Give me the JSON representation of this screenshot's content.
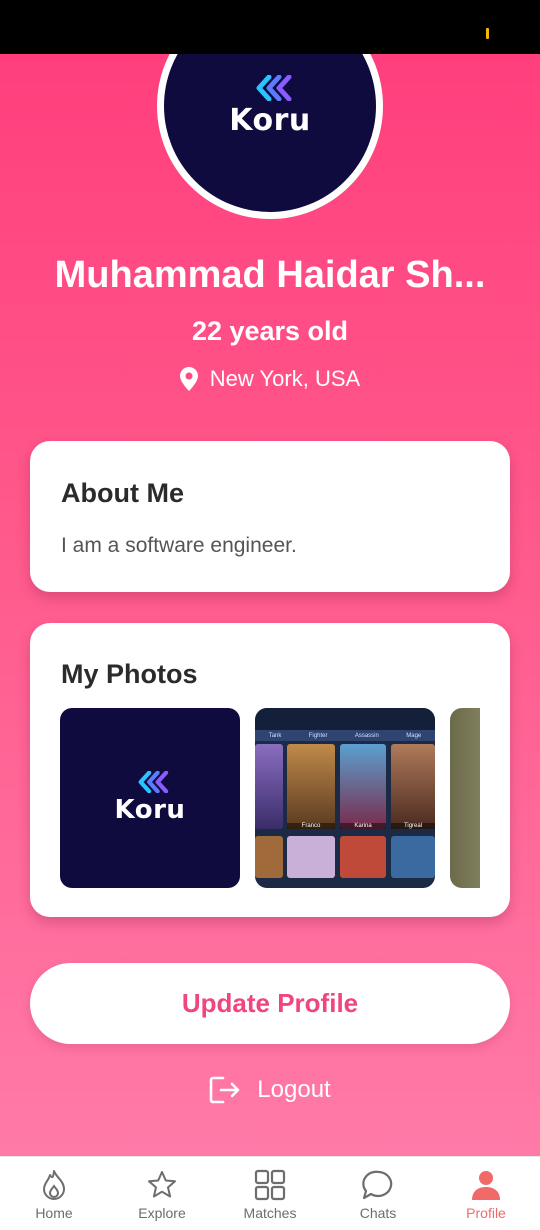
{
  "profile": {
    "name": "Muhammad Haidar Sh...",
    "age": "22 years old",
    "location": "New York, USA",
    "avatar_logo": "Koru"
  },
  "about": {
    "title": "About Me",
    "text": "I am a software engineer."
  },
  "photos": {
    "title": "My Photos",
    "items": [
      {
        "logo": "Koru"
      },
      {
        "tabs": [
          "Tank",
          "Fighter",
          "Assassin",
          "Mage"
        ],
        "heroes": [
          "Franco",
          "Karina",
          "Tigreal"
        ]
      },
      {}
    ]
  },
  "actions": {
    "update_label": "Update Profile",
    "logout_label": "Logout"
  },
  "nav": {
    "items": [
      {
        "label": "Home",
        "icon": "flame-icon"
      },
      {
        "label": "Explore",
        "icon": "star-icon"
      },
      {
        "label": "Matches",
        "icon": "grid-icon"
      },
      {
        "label": "Chats",
        "icon": "chat-bubble-icon"
      },
      {
        "label": "Profile",
        "icon": "person-icon",
        "active": true
      }
    ]
  },
  "colors": {
    "accent": "#f0457e",
    "nav_active": "#f06a6a",
    "logo_bg": "#0f0b3f"
  }
}
